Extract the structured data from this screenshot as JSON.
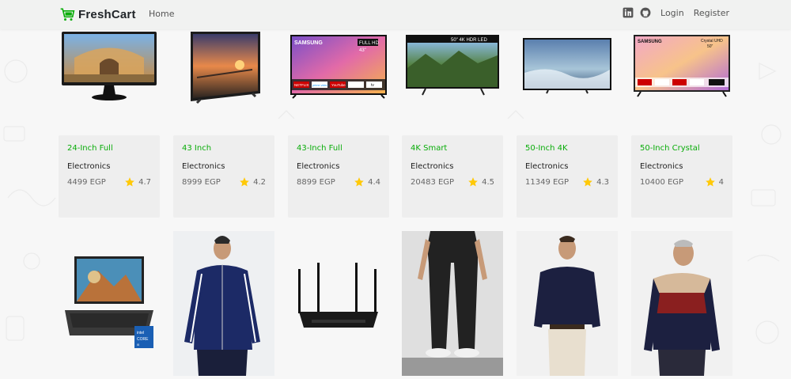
{
  "navbar": {
    "brand": "FreshCart",
    "home": "Home",
    "login": "Login",
    "register": "Register",
    "icons": [
      "linkedin-icon",
      "github-icon"
    ]
  },
  "colors": {
    "accent": "#0aad0a",
    "star": "#ffc908",
    "card_bg": "#eeeeee"
  },
  "products_row1": [
    {
      "title": "24-Inch Full",
      "category": "Electronics",
      "price": "4499 EGP",
      "rating": "4.7"
    },
    {
      "title": "43 Inch",
      "category": "Electronics",
      "price": "8999 EGP",
      "rating": "4.2"
    },
    {
      "title": "43-Inch Full",
      "category": "Electronics",
      "price": "8899 EGP",
      "rating": "4.4"
    },
    {
      "title": "4K Smart",
      "category": "Electronics",
      "price": "20483 EGP",
      "rating": "4.5"
    },
    {
      "title": "50-Inch 4K",
      "category": "Electronics",
      "price": "11349 EGP",
      "rating": "4.3"
    },
    {
      "title": "50-Inch Crystal",
      "category": "Electronics",
      "price": "10400 EGP",
      "rating": "4"
    }
  ],
  "image_text": {
    "samsung": "SAMSUNG",
    "full_hd": "FULL HD",
    "hdr_led": "50\" 4K HDR LED",
    "crystal_uhd": "Crystal UHD",
    "size_50": "50\"",
    "size_43": "43\"",
    "netflix": "NETFLIX",
    "prime": "prime video",
    "youtube": "YouTube",
    "tv": "tv",
    "intel": "intel",
    "core": "CORE",
    "i5": "i5"
  },
  "products_row2": [
    {
      "image": "laptop"
    },
    {
      "image": "track-jacket"
    },
    {
      "image": "wifi-router"
    },
    {
      "image": "track-pants"
    },
    {
      "image": "navy-sweater"
    },
    {
      "image": "striped-sweater"
    }
  ]
}
